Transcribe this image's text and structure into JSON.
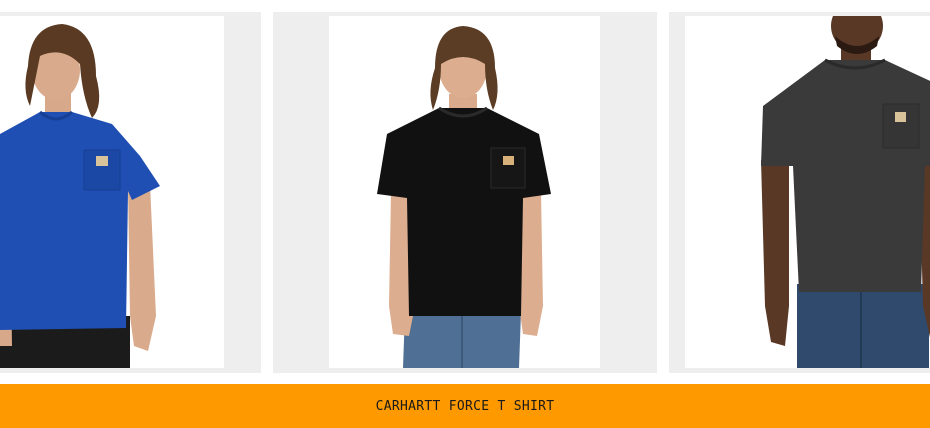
{
  "banner": {
    "title": "CARHARTT FORCE T SHIRT",
    "background_color": "#ff9900"
  },
  "products": [
    {
      "shirt_color": "#1f4fb3",
      "pocket_label": "carhartt-pocket-logo"
    },
    {
      "shirt_color": "#111111",
      "pocket_label": "carhartt-pocket-logo"
    },
    {
      "shirt_color": "#3a3a3a",
      "pocket_label": "carhartt-pocket-logo"
    }
  ]
}
